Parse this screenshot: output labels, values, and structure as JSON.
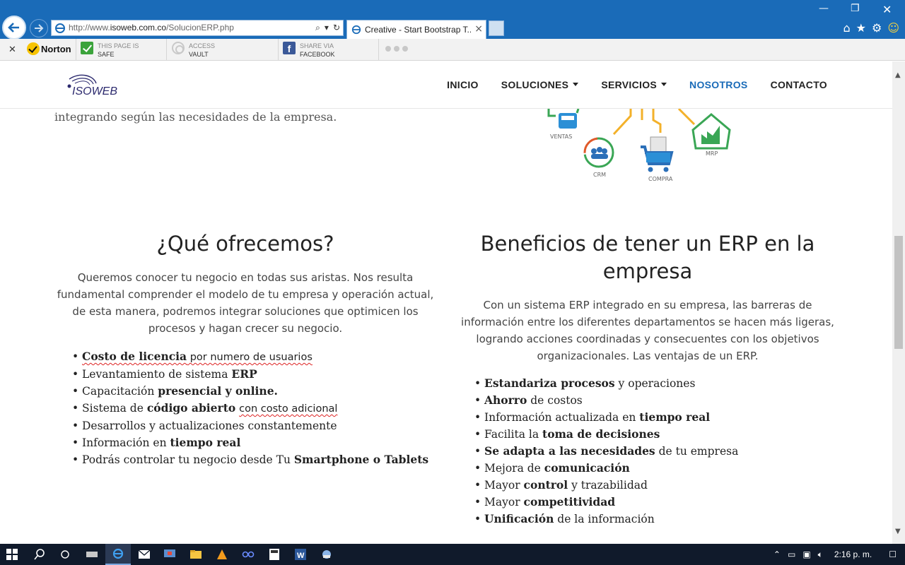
{
  "browser": {
    "url_prefix": "http://www.",
    "url_domain": "isoweb.com.co",
    "url_path": "/SolucionERP.php",
    "tab_title": "Creative - Start Bootstrap T..."
  },
  "toolbar": {
    "norton_label": "Norton",
    "safe_line1": "THIS PAGE IS",
    "safe_line2": "SAFE",
    "vault_line1": "ACCESS",
    "vault_line2": "VAULT",
    "fb_line1": "SHARE VIA",
    "fb_line2": "FACEBOOK"
  },
  "site": {
    "logo_text": "ISOWEB",
    "nav": [
      {
        "label": "INICIO",
        "dropdown": false,
        "active": false
      },
      {
        "label": "SOLUCIONES",
        "dropdown": true,
        "active": false
      },
      {
        "label": "SERVICIOS",
        "dropdown": true,
        "active": false
      },
      {
        "label": "NOSOTROS",
        "dropdown": false,
        "active": true
      },
      {
        "label": "CONTACTO",
        "dropdown": false,
        "active": false
      }
    ]
  },
  "intro_tail": "integrando según las necesidades de la empresa.",
  "graphic_labels": {
    "ventas": "VENTAS",
    "crm": "CRM",
    "compra": "COMPRA",
    "mrp": "MRP"
  },
  "left": {
    "title": "¿Qué ofrecemos?",
    "lead": "Queremos conocer tu negocio en todas sus aristas. Nos resulta fundamental comprender el modelo de tu empresa y operación actual, de esta manera, podremos integrar soluciones que optimicen los procesos y hagan crecer su negocio.",
    "items": {
      "i0a": "Costo de licencia",
      "i0b": " por numero de usuarios",
      "i1a": "Levantamiento de sistema ",
      "i1b": "ERP",
      "i2a": "Capacitación ",
      "i2b": "presencial y online.",
      "i3a": "Sistema de ",
      "i3b": "código abierto",
      "i3c": "con costo adicional",
      "i4": "Desarrollos y actualizaciones constantemente",
      "i5a": "Información en ",
      "i5b": "tiempo real",
      "i6a": "Podrás controlar tu negocio desde Tu ",
      "i6b": "Smartphone o Tablets"
    }
  },
  "right": {
    "title": "Beneficios de tener un ERP en la empresa",
    "lead": "Con un sistema ERP integrado en su empresa, las barreras de información entre los diferentes departamentos se hacen más ligeras, logrando acciones coordinadas y consecuentes con los objetivos organizacionales. Las ventajas de un ERP.",
    "items": {
      "i0a": "Estandariza procesos",
      "i0b": " y operaciones",
      "i1a": "Ahorro",
      "i1b": " de costos",
      "i2a": "Información actualizada en ",
      "i2b": "tiempo real",
      "i3a": "Facilita la ",
      "i3b": "toma de decisiones",
      "i4a": "Se adapta a las necesidades",
      "i4b": " de tu empresa",
      "i5a": "Mejora de ",
      "i5b": "comunicación",
      "i6a": "Mayor ",
      "i6b": "control",
      "i6c": " y trazabilidad",
      "i7a": "Mayor ",
      "i7b": "competitividad",
      "i8a": "Unificación",
      "i8b": " de la información"
    }
  },
  "taskbar": {
    "clock": "2:16 p. m."
  },
  "colors": {
    "ie_blue": "#1a6bb8",
    "nav_active": "#1a6bb8",
    "taskbar": "#101a2b"
  }
}
